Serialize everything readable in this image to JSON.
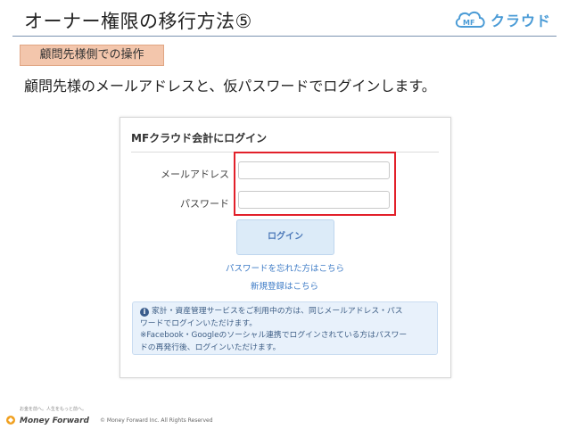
{
  "slide": {
    "title": "オーナー権限の移行方法⑤",
    "brand_logo_text": "クラウド",
    "section_tag": "顧問先様側での操作",
    "lead_text": "顧問先様のメールアドレスと、仮パスワードでログインします。"
  },
  "login_panel": {
    "title": "MFクラウド会計にログイン",
    "email_label": "メールアドレス",
    "email_value": "",
    "password_label": "パスワード",
    "password_value": "",
    "login_button": "ログイン",
    "forgot_password_link": "パスワードを忘れた方はこちら",
    "signup_link": "新規登録はこちら",
    "notice_lines": [
      "家計・資産管理サービスをご利用中の方は、同じメールアドレス・パス",
      "ワードでログインいただけます。",
      "※Facebook・Googleのソーシャル連携でログインされている方はパスワー",
      "ドの再発行後、ログインいただけます。"
    ]
  },
  "footer": {
    "tagline": "お金を前へ。人生をもっと前へ。",
    "brand": "Money Forward",
    "copyright": "© Money Forward Inc. All Rights Reserved"
  },
  "colors": {
    "highlight": "#e2202a",
    "section_tag_bg": "#f3c6ac",
    "brand_blue": "#4a9bd6",
    "link_blue": "#3d7bc6"
  }
}
